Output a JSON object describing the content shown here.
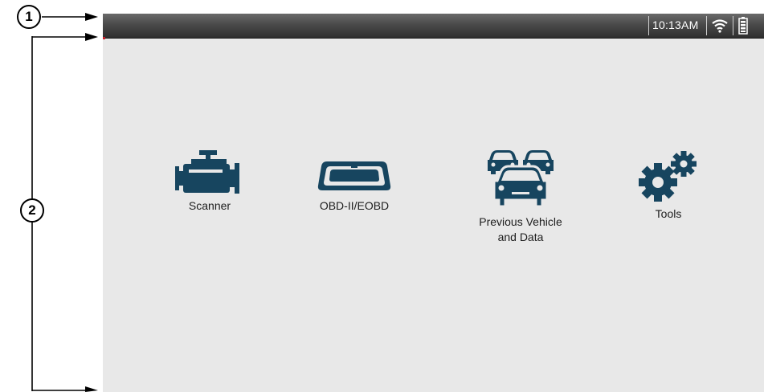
{
  "annotations": {
    "callout_1": "1",
    "callout_2": "2"
  },
  "status_bar": {
    "time": "10:13AM",
    "icons": [
      "wifi-icon",
      "battery-icon"
    ]
  },
  "apps": [
    {
      "label": "Scanner",
      "icon": "engine-icon"
    },
    {
      "label": "OBD-II/EOBD",
      "icon": "obd-connector-icon"
    },
    {
      "label": "Previous Vehicle and Data",
      "label_line1": "Previous Vehicle",
      "label_line2": "and Data",
      "icon": "vehicles-icon"
    },
    {
      "label": "Tools",
      "icon": "gears-icon"
    }
  ],
  "colors": {
    "icon": "#17455f",
    "screen_bg": "#e8e8e8",
    "status_bar": "#3a3a3a",
    "accent": "#c8202a"
  }
}
